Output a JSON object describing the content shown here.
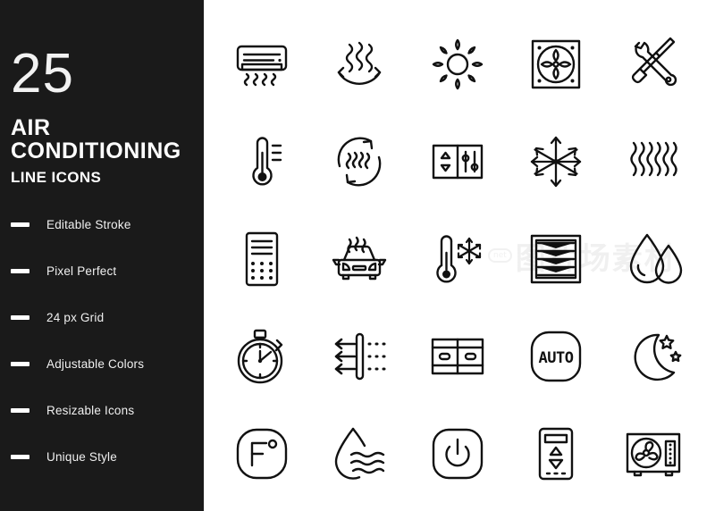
{
  "sidebar": {
    "count": "25",
    "title": "AIR\nCONDITIONING",
    "title_line1": "AIR",
    "title_line2": "CONDITIONING",
    "subtitle": "LINE ICONS",
    "background_color": "#1a1a1a",
    "text_color": "#ffffff",
    "features": [
      {
        "label": "Editable Stroke"
      },
      {
        "label": "Pixel Perfect"
      },
      {
        "label": "24 px Grid"
      },
      {
        "label": "Adjustable Colors"
      },
      {
        "label": "Resizable Icons"
      },
      {
        "label": "Unique Style"
      }
    ]
  },
  "icon_grid": {
    "columns": 5,
    "rows": 5,
    "stroke_color": "#111111",
    "background_color": "#ffffff",
    "icons": [
      {
        "name": "air-conditioner-unit-icon",
        "label": "Air Conditioner Unit"
      },
      {
        "name": "heat-wave-airflow-icon",
        "label": "Warm Air Flow"
      },
      {
        "name": "sun-icon",
        "label": "Sun"
      },
      {
        "name": "ventilation-fan-panel-icon",
        "label": "Ventilation Fan Panel"
      },
      {
        "name": "wrench-screwdriver-repair-icon",
        "label": "Repair Tools"
      },
      {
        "name": "thermometer-icon",
        "label": "Thermometer"
      },
      {
        "name": "air-circulation-icon",
        "label": "Air Circulation"
      },
      {
        "name": "control-panel-icon",
        "label": "Control Panel"
      },
      {
        "name": "snowflake-icon",
        "label": "Snowflake"
      },
      {
        "name": "heat-waves-icon",
        "label": "Heat Waves"
      },
      {
        "name": "remote-control-icon",
        "label": "Remote Control"
      },
      {
        "name": "car-air-conditioning-icon",
        "label": "Car Air Conditioning"
      },
      {
        "name": "thermometer-cold-icon",
        "label": "Cold Temperature"
      },
      {
        "name": "air-vent-louver-icon",
        "label": "Air Vent Louver"
      },
      {
        "name": "water-drops-icon",
        "label": "Water Drops"
      },
      {
        "name": "timer-stopwatch-icon",
        "label": "Timer"
      },
      {
        "name": "air-filter-icon",
        "label": "Air Filter"
      },
      {
        "name": "double-grille-vent-icon",
        "label": "Double Grille Vent"
      },
      {
        "name": "auto-mode-icon",
        "label": "Auto Mode"
      },
      {
        "name": "night-mode-moon-icon",
        "label": "Night Mode"
      },
      {
        "name": "fahrenheit-degree-icon",
        "label": "Fahrenheit Degree"
      },
      {
        "name": "humidity-drop-icon",
        "label": "Humidity"
      },
      {
        "name": "power-button-icon",
        "label": "Power Button"
      },
      {
        "name": "thermostat-icon",
        "label": "Thermostat"
      },
      {
        "name": "outdoor-condenser-unit-icon",
        "label": "Outdoor Condenser Unit"
      }
    ],
    "auto_mode_text": "AUTO",
    "fahrenheit_text": "F"
  },
  "watermark": {
    "logo_text": "net",
    "text": "图片场素材"
  }
}
